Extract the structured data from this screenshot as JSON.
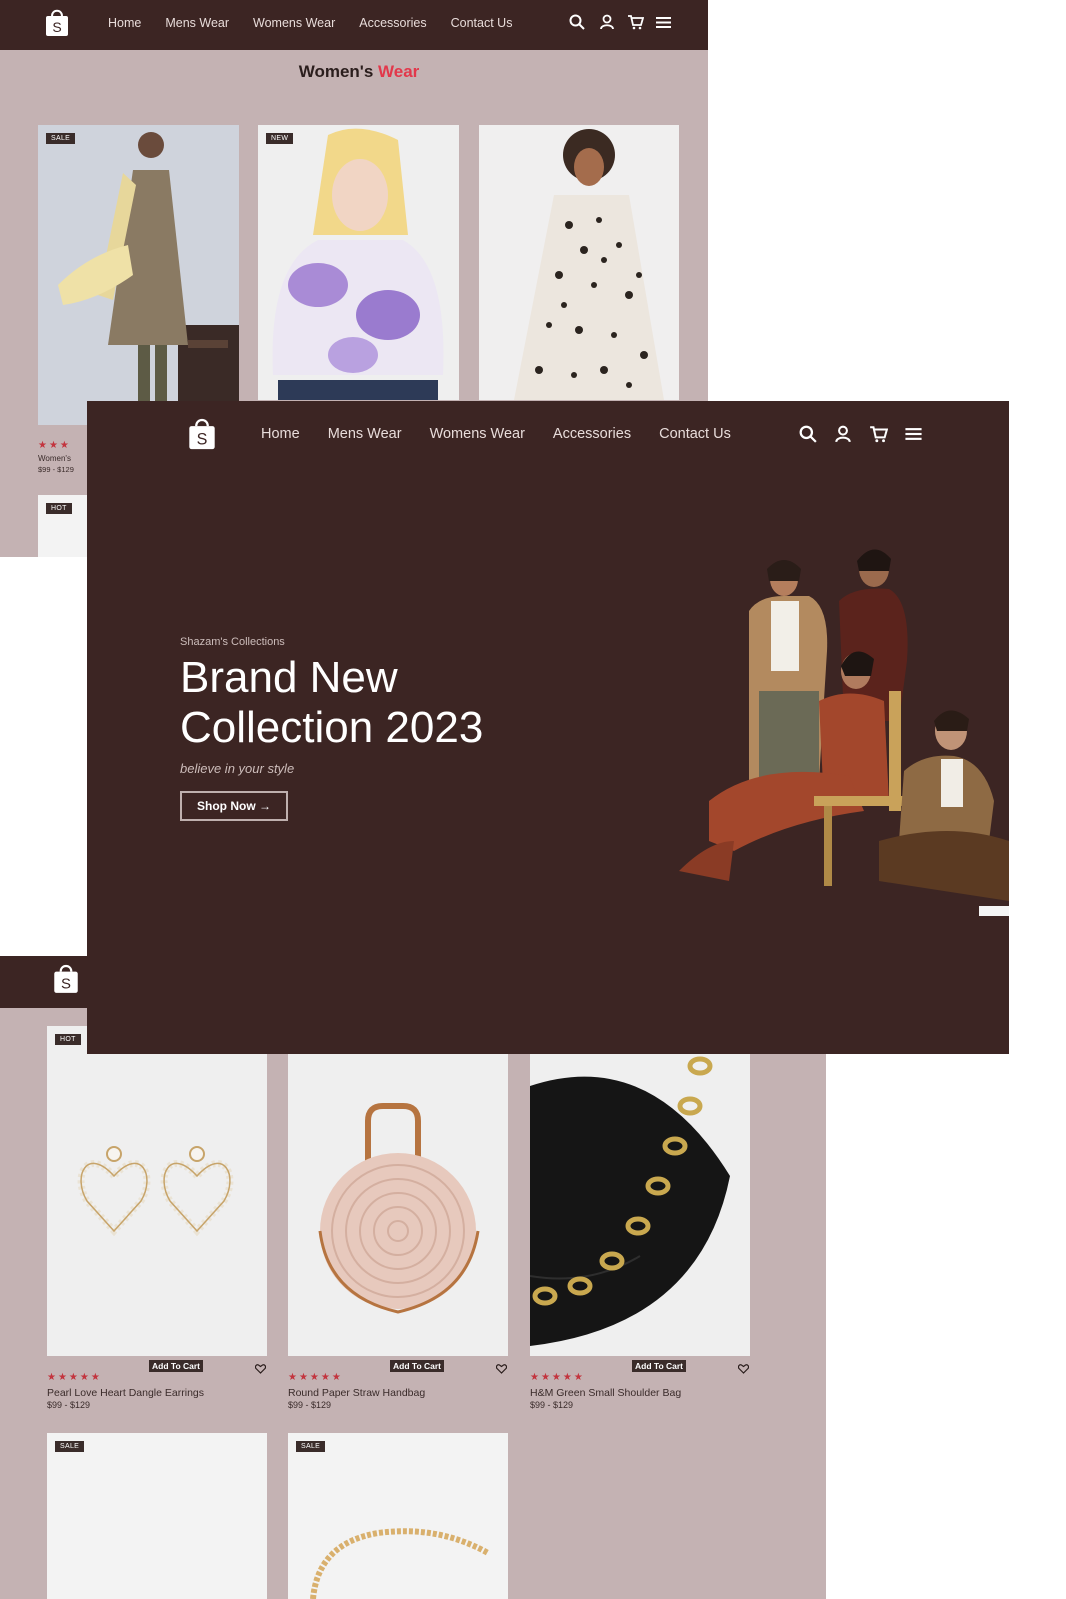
{
  "nav": {
    "links": [
      "Home",
      "Mens Wear",
      "Womens Wear",
      "Accessories",
      "Contact Us"
    ],
    "icons": [
      "search-icon",
      "user-icon",
      "cart-icon",
      "menu-icon"
    ],
    "logo_letter": "S"
  },
  "womens": {
    "title_part1": "Women's ",
    "title_part2": "Wear",
    "cards": [
      {
        "tag": "SALE",
        "name": "Women's",
        "price": "$99 - $129",
        "rating": "4.5"
      },
      {
        "tag": "NEW"
      },
      {
        "tag": ""
      }
    ],
    "second_row_tag": "HOT"
  },
  "hero": {
    "eyebrow": "Shazam's Collections",
    "title_line1": "Brand New",
    "title_line2": "Collection 2023",
    "tagline": "believe in your style",
    "cta": "Shop Now →"
  },
  "accessories": {
    "cards": [
      {
        "tag": "HOT",
        "name": "Pearl Love Heart Dangle Earrings",
        "price": "$99 - $129",
        "cart": "Add To Cart",
        "rating": "4.5"
      },
      {
        "tag": "",
        "name": "Round Paper Straw Handbag",
        "price": "$99 - $129",
        "cart": "Add To Cart",
        "rating": "4.5"
      },
      {
        "tag": "",
        "name": "H&M Green Small Shoulder Bag",
        "price": "$99 - $129",
        "cart": "Add To Cart",
        "rating": "4.5"
      }
    ],
    "row2_tags": [
      "SALE",
      "SALE"
    ]
  },
  "colors": {
    "brown": "#3c2523",
    "mauve": "#c4b2b3",
    "accent_red": "#e2384b",
    "star_red": "#c3343e"
  }
}
